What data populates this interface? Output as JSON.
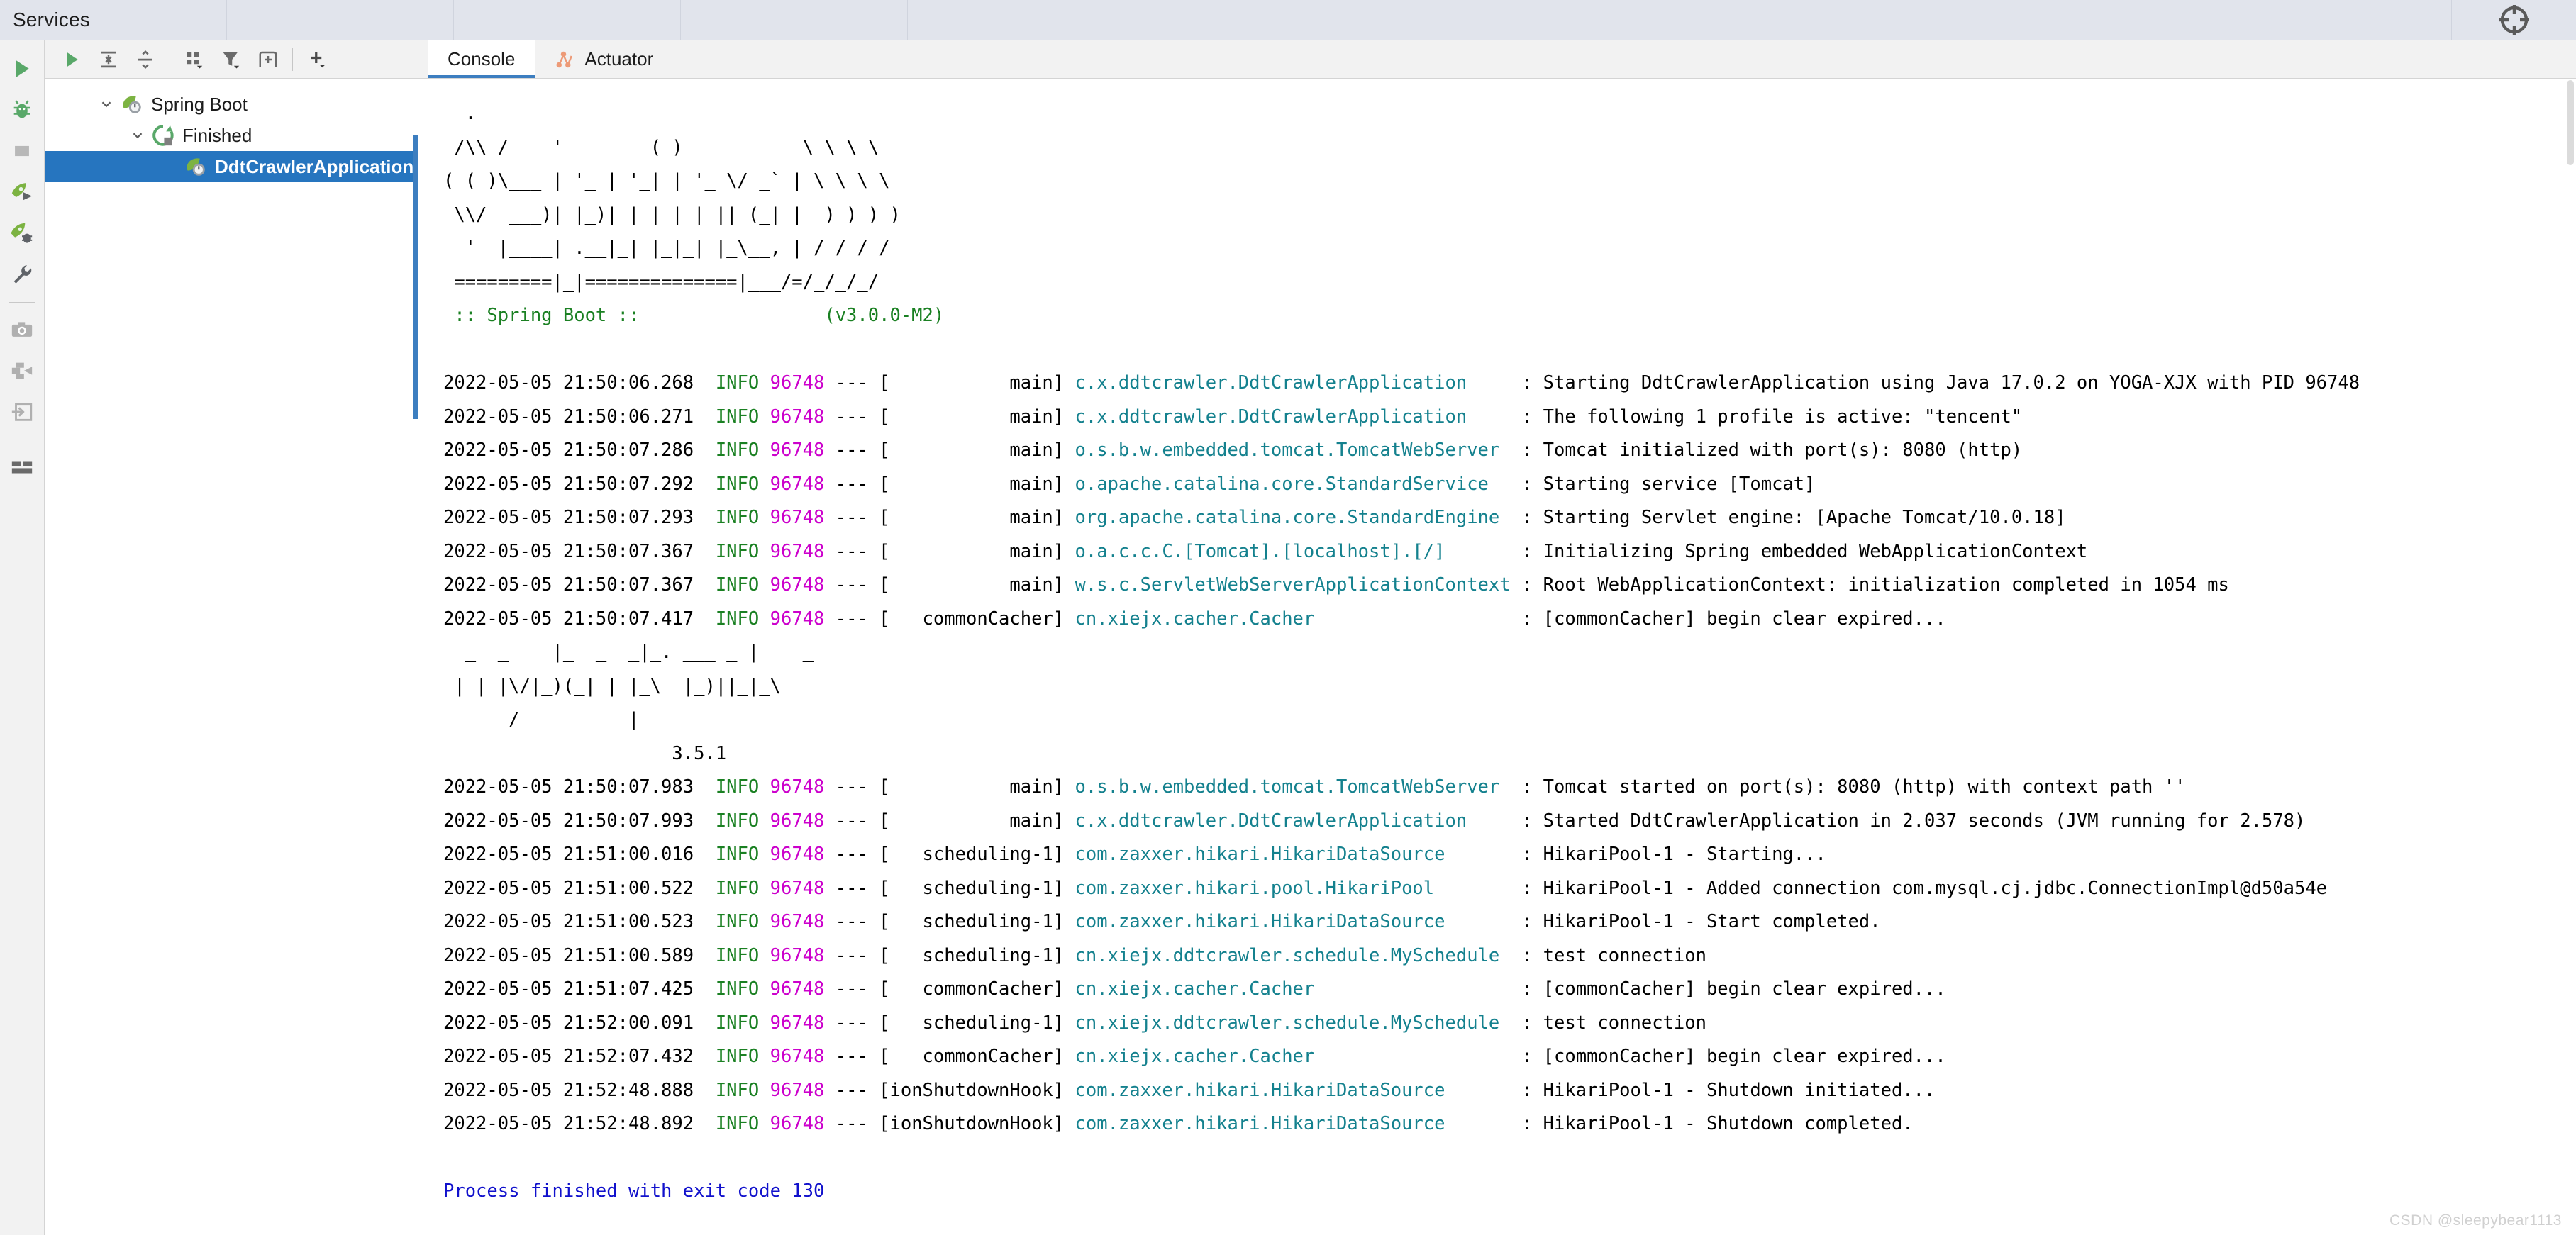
{
  "window": {
    "top_tabs": [
      {
        "label": "Services"
      },
      {
        "label": ""
      },
      {
        "label": ""
      },
      {
        "label": ""
      },
      {
        "label": ""
      }
    ],
    "settings_icon": "crosshair-target-icon"
  },
  "rail": {
    "items": [
      {
        "name": "run-icon",
        "tooltip": "Run"
      },
      {
        "name": "debug-bug-icon",
        "tooltip": "Debug"
      },
      {
        "name": "stop-icon",
        "tooltip": "Stop"
      },
      {
        "name": "rerun-rocket-icon",
        "tooltip": "Rerun"
      },
      {
        "name": "rocket-debug-icon",
        "tooltip": "Debug Rocket"
      },
      {
        "name": "wrench-icon",
        "tooltip": "Edit Configuration"
      },
      {
        "name": "camera-icon",
        "tooltip": "Snapshot"
      },
      {
        "name": "thread-dump-icon",
        "tooltip": "Thread Dump"
      },
      {
        "name": "attach-process-icon",
        "tooltip": "Attach"
      },
      {
        "name": "layout-icon",
        "tooltip": "Layout"
      }
    ]
  },
  "left_toolbar": {
    "items": [
      {
        "name": "run-all-icon"
      },
      {
        "name": "expand-all-icon"
      },
      {
        "name": "collapse-all-icon"
      },
      {
        "name": "group-by-icon"
      },
      {
        "name": "filter-icon"
      },
      {
        "name": "add-tab-icon"
      },
      {
        "name": "add-service-icon"
      }
    ]
  },
  "tree": {
    "nodes": [
      {
        "label": "Spring Boot",
        "icon": "spring-boot-leaf-icon",
        "level": 0,
        "expanded": true,
        "selected": false,
        "twisty": "chevron-down-icon"
      },
      {
        "label": "Finished",
        "icon": "rerun-finished-icon",
        "level": 1,
        "expanded": true,
        "selected": false,
        "twisty": "chevron-down-icon"
      },
      {
        "label": "DdtCrawlerApplication",
        "icon": "spring-boot-leaf-icon",
        "level": 2,
        "expanded": false,
        "selected": true,
        "twisty": ""
      }
    ]
  },
  "tabs": [
    {
      "label": "Console",
      "icon": "",
      "active": true
    },
    {
      "label": "Actuator",
      "icon": "actuator-graph-icon",
      "active": false
    }
  ],
  "console": {
    "banner": [
      "  .   ____          _            __ _ _",
      " /\\\\ / ___'_ __ _ _(_)_ __  __ _ \\ \\ \\ \\",
      "( ( )\\___ | '_ | '_| | '_ \\/ _` | \\ \\ \\ \\",
      " \\\\/  ___)| |_)| | | | | || (_| |  ) ) ) )",
      "  '  |____| .__|_| |_|_| |_\\__, | / / / /",
      " =========|_|==============|___/=/_/_/_/"
    ],
    "banner_version_line": {
      "name_text": " :: Spring Boot :: ",
      "pad": "                ",
      "version": "(v3.0.0-M2)"
    },
    "cacher_banner": [
      "  _  _    |_  _  _|_. ___ _ |    _",
      " | | |\\/|_)(_| | |_\\  |_)||_|_\\",
      "      /          |",
      "                     3.5.1"
    ],
    "lines": [
      {
        "ts": "2022-05-05 21:50:06.268",
        "level": "INFO",
        "pid": "96748",
        "thread": "main",
        "logger": "c.x.ddtcrawler.DdtCrawlerApplication",
        "msg": "Starting DdtCrawlerApplication using Java 17.0.2 on YOGA-XJX with PID 96748"
      },
      {
        "ts": "2022-05-05 21:50:06.271",
        "level": "INFO",
        "pid": "96748",
        "thread": "main",
        "logger": "c.x.ddtcrawler.DdtCrawlerApplication",
        "msg": "The following 1 profile is active: \"tencent\""
      },
      {
        "ts": "2022-05-05 21:50:07.286",
        "level": "INFO",
        "pid": "96748",
        "thread": "main",
        "logger": "o.s.b.w.embedded.tomcat.TomcatWebServer",
        "msg": "Tomcat initialized with port(s): 8080 (http)"
      },
      {
        "ts": "2022-05-05 21:50:07.292",
        "level": "INFO",
        "pid": "96748",
        "thread": "main",
        "logger": "o.apache.catalina.core.StandardService",
        "msg": "Starting service [Tomcat]"
      },
      {
        "ts": "2022-05-05 21:50:07.293",
        "level": "INFO",
        "pid": "96748",
        "thread": "main",
        "logger": "org.apache.catalina.core.StandardEngine",
        "msg": "Starting Servlet engine: [Apache Tomcat/10.0.18]"
      },
      {
        "ts": "2022-05-05 21:50:07.367",
        "level": "INFO",
        "pid": "96748",
        "thread": "main",
        "logger": "o.a.c.c.C.[Tomcat].[localhost].[/]",
        "msg": "Initializing Spring embedded WebApplicationContext"
      },
      {
        "ts": "2022-05-05 21:50:07.367",
        "level": "INFO",
        "pid": "96748",
        "thread": "main",
        "logger": "w.s.c.ServletWebServerApplicationContext",
        "msg": "Root WebApplicationContext: initialization completed in 1054 ms"
      },
      {
        "ts": "2022-05-05 21:50:07.417",
        "level": "INFO",
        "pid": "96748",
        "thread": "commonCacher",
        "logger": "cn.xiejx.cacher.Cacher",
        "msg": "[commonCacher] begin clear expired..."
      }
    ],
    "lines2": [
      {
        "ts": "2022-05-05 21:50:07.983",
        "level": "INFO",
        "pid": "96748",
        "thread": "main",
        "logger": "o.s.b.w.embedded.tomcat.TomcatWebServer",
        "msg": "Tomcat started on port(s): 8080 (http) with context path ''"
      },
      {
        "ts": "2022-05-05 21:50:07.993",
        "level": "INFO",
        "pid": "96748",
        "thread": "main",
        "logger": "c.x.ddtcrawler.DdtCrawlerApplication",
        "msg": "Started DdtCrawlerApplication in 2.037 seconds (JVM running for 2.578)"
      },
      {
        "ts": "2022-05-05 21:51:00.016",
        "level": "INFO",
        "pid": "96748",
        "thread": "scheduling-1",
        "logger": "com.zaxxer.hikari.HikariDataSource",
        "msg": "HikariPool-1 - Starting..."
      },
      {
        "ts": "2022-05-05 21:51:00.522",
        "level": "INFO",
        "pid": "96748",
        "thread": "scheduling-1",
        "logger": "com.zaxxer.hikari.pool.HikariPool",
        "msg": "HikariPool-1 - Added connection com.mysql.cj.jdbc.ConnectionImpl@d50a54e"
      },
      {
        "ts": "2022-05-05 21:51:00.523",
        "level": "INFO",
        "pid": "96748",
        "thread": "scheduling-1",
        "logger": "com.zaxxer.hikari.HikariDataSource",
        "msg": "HikariPool-1 - Start completed."
      },
      {
        "ts": "2022-05-05 21:51:00.589",
        "level": "INFO",
        "pid": "96748",
        "thread": "scheduling-1",
        "logger": "cn.xiejx.ddtcrawler.schedule.MySchedule",
        "msg": "test connection"
      },
      {
        "ts": "2022-05-05 21:51:07.425",
        "level": "INFO",
        "pid": "96748",
        "thread": "commonCacher",
        "logger": "cn.xiejx.cacher.Cacher",
        "msg": "[commonCacher] begin clear expired..."
      },
      {
        "ts": "2022-05-05 21:52:00.091",
        "level": "INFO",
        "pid": "96748",
        "thread": "scheduling-1",
        "logger": "cn.xiejx.ddtcrawler.schedule.MySchedule",
        "msg": "test connection"
      },
      {
        "ts": "2022-05-05 21:52:07.432",
        "level": "INFO",
        "pid": "96748",
        "thread": "commonCacher",
        "logger": "cn.xiejx.cacher.Cacher",
        "msg": "[commonCacher] begin clear expired..."
      },
      {
        "ts": "2022-05-05 21:52:48.888",
        "level": "INFO",
        "pid": "96748",
        "thread": "ionShutdownHook",
        "logger": "com.zaxxer.hikari.HikariDataSource",
        "msg": "HikariPool-1 - Shutdown initiated..."
      },
      {
        "ts": "2022-05-05 21:52:48.892",
        "level": "INFO",
        "pid": "96748",
        "thread": "ionShutdownHook",
        "logger": "com.zaxxer.hikari.HikariDataSource",
        "msg": "HikariPool-1 - Shutdown completed."
      }
    ],
    "exit_message": "Process finished with exit code 130"
  },
  "watermark": "CSDN @sleepybear1113",
  "colors": {
    "selection_blue": "#2675bf",
    "log_level": "#1a8022",
    "log_pid": "#cc00cc",
    "logger_name": "#14818e",
    "exit_text": "#1111cc",
    "tab_underline": "#3c7ec0",
    "titlebar_bg": "#e1e4ec",
    "toolbar_bg": "#f2f2f2"
  }
}
